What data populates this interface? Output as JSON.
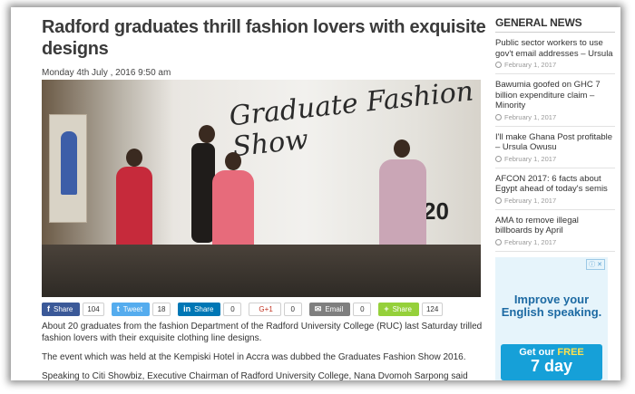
{
  "article": {
    "title": "Radford graduates thrill fashion lovers with exquisite designs",
    "date": "Monday 4th July , 2016 9:50 am",
    "photo": {
      "backdrop_text": "Graduate Fashion Show",
      "backdrop_year": "20"
    },
    "paragraphs": [
      "About 20 graduates from the fashion Department of the Radford University College (RUC) last Saturday trilled fashion lovers with their exquisite clothing line designs.",
      "The event which was held at the Kempiski Hotel in Accra was dubbed the Graduates Fashion Show 2016.",
      "Speaking to Citi Showbiz, Executive Chairman of Radford University College, Nana Dvomoh Sarpong said"
    ]
  },
  "share": [
    {
      "label": "Share",
      "icon": "facebook-icon",
      "glyph": "f",
      "count": "104",
      "color": "#3b5998"
    },
    {
      "label": "Tweet",
      "icon": "twitter-icon",
      "glyph": "t",
      "count": "18",
      "color": "#55acee"
    },
    {
      "label": "Share",
      "icon": "linkedin-icon",
      "glyph": "in",
      "count": "0",
      "color": "#0077b5"
    },
    {
      "label": "G+1",
      "icon": "google-plus-icon",
      "glyph": "",
      "count": "0",
      "color": "#ffffff"
    },
    {
      "label": "Email",
      "icon": "email-icon",
      "glyph": "✉",
      "count": "0",
      "color": "#7f7f7f"
    },
    {
      "label": "Share",
      "icon": "share-icon",
      "glyph": "+",
      "count": "124",
      "color": "#95d03a"
    }
  ],
  "sidebar": {
    "heading": "GENERAL NEWS",
    "items": [
      {
        "headline": "Public sector workers to use gov't email addresses – Ursula",
        "date": "February 1, 2017"
      },
      {
        "headline": "Bawumia goofed on GHC 7 billion expenditure claim – Minority",
        "date": "February 1, 2017"
      },
      {
        "headline": "I'll make Ghana Post profitable – Ursula Owusu",
        "date": "February 1, 2017"
      },
      {
        "headline": "AFCON 2017: 6 facts about Egypt ahead of today's semis",
        "date": "February 1, 2017"
      },
      {
        "headline": "AMA to remove illegal billboards by April",
        "date": "February 1, 2017"
      }
    ]
  },
  "ad": {
    "headline": "Improve your English speaking.",
    "cta_prefix": "Get our",
    "cta_free": "FREE",
    "cta_line2": "7 day"
  }
}
